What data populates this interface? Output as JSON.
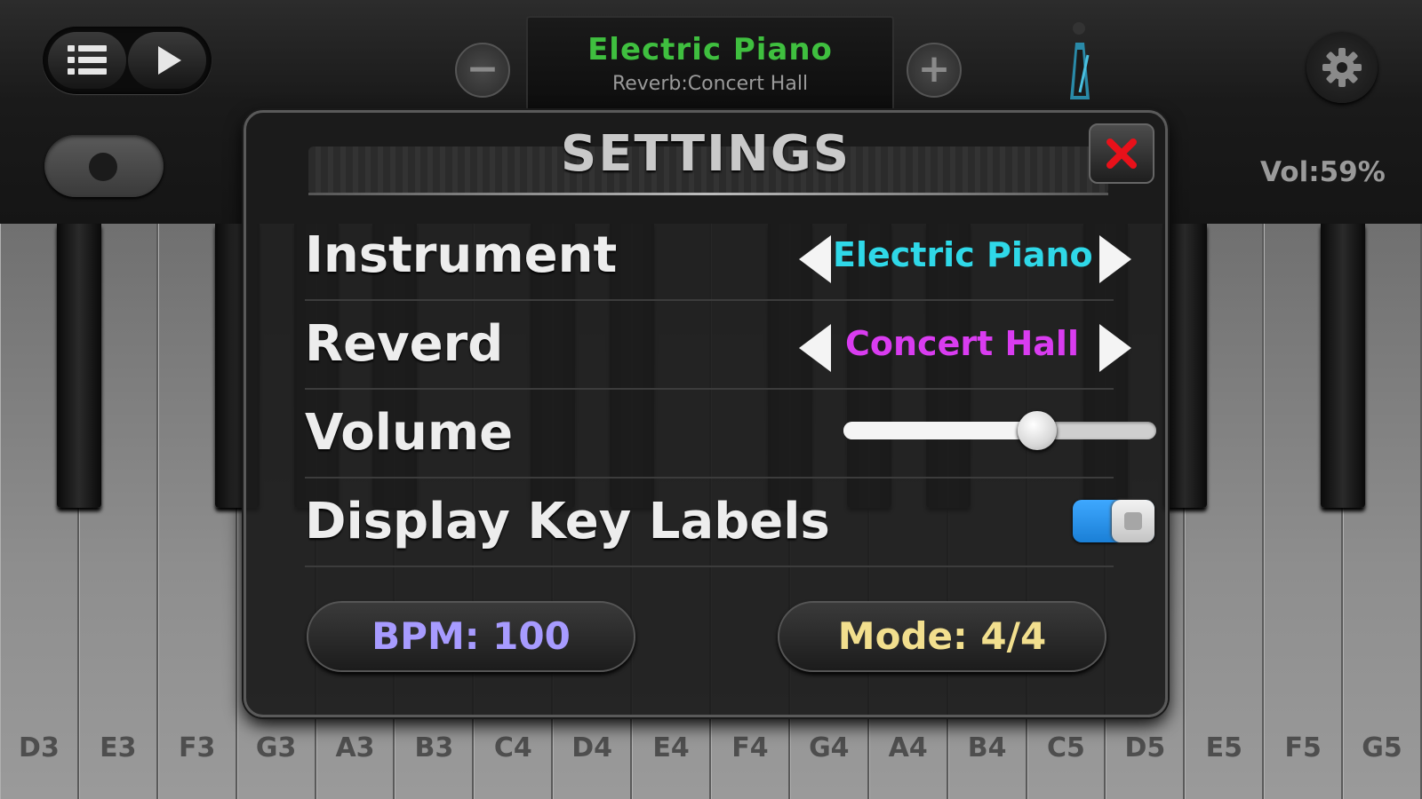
{
  "topbar": {
    "display_instrument": "Electric Piano",
    "display_reverb": "Reverb:Concert Hall",
    "volume_text": "Vol:59%",
    "minus_label": "−",
    "plus_label": "+"
  },
  "keyboard": {
    "white_keys": [
      "D3",
      "E3",
      "F3",
      "G3",
      "A3",
      "B3",
      "C4",
      "D4",
      "E4",
      "F4",
      "G4",
      "A4",
      "B4",
      "C5",
      "D5",
      "E5",
      "F5",
      "G5"
    ]
  },
  "settings": {
    "title": "SETTINGS",
    "instrument": {
      "label": "Instrument",
      "value": "Electric Piano",
      "color": "#2fd8e8"
    },
    "reverb": {
      "label": "Reverd",
      "value": "Concert Hall",
      "color": "#d93cf0"
    },
    "volume": {
      "label": "Volume",
      "percent": 62
    },
    "key_labels": {
      "label": "Display Key Labels",
      "enabled": true
    },
    "bpm_label": "BPM: 100",
    "mode_label": "Mode: 4/4"
  },
  "colors": {
    "display_green": "#3fbf3f",
    "bpm_purple": "#a79bff",
    "mode_yellow": "#f2df8e",
    "toggle_blue": "#1a7fd6",
    "close_red": "#e8111a"
  },
  "icons": [
    "list-icon",
    "play-icon",
    "minus-icon",
    "plus-icon",
    "metronome-icon",
    "gear-icon",
    "close-icon",
    "arrow-left-icon",
    "arrow-right-icon"
  ]
}
